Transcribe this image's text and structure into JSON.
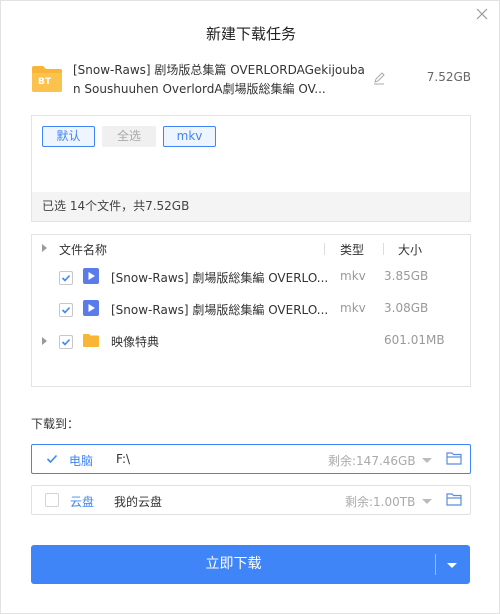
{
  "dialog": {
    "title": "新建下载任务"
  },
  "file": {
    "icon_label": "BT",
    "name": "[Snow-Raws] 剧场版总集篇 OVERLORDAGekijouban Soushuuhen OverlordA劇場版総集編 OV...",
    "size": "7.52GB"
  },
  "filters": {
    "default_label": "默认",
    "select_all_label": "全选",
    "mkv_label": "mkv",
    "summary": "已选 14个文件，共7.52GB"
  },
  "file_tree": {
    "headers": {
      "name": "文件名称",
      "type": "类型",
      "size": "大小"
    },
    "rows": [
      {
        "name": "[Snow-Raws] 劇場版総集編 OVERLO...",
        "type": "mkv",
        "size": "3.85GB",
        "icon": "video-icon",
        "checked": true
      },
      {
        "name": "[Snow-Raws] 劇場版総集編 OVERLO...",
        "type": "mkv",
        "size": "3.08GB",
        "icon": "video-icon",
        "checked": true
      },
      {
        "name": "映像特典",
        "type": "",
        "size": "601.01MB",
        "icon": "folder-icon",
        "checked": true
      }
    ]
  },
  "destinations": {
    "label": "下载到：",
    "items": [
      {
        "name": "电脑",
        "path": "F:\\",
        "free": "剩余:147.46GB",
        "checked": true
      },
      {
        "name": "云盘",
        "path": "我的云盘",
        "free": "剩余:1.00TB",
        "checked": false
      }
    ]
  },
  "actions": {
    "download_label": "立即下载"
  },
  "colors": {
    "accent": "#3f85f7",
    "folder": "#f9b536",
    "video": "#5b7be8"
  }
}
